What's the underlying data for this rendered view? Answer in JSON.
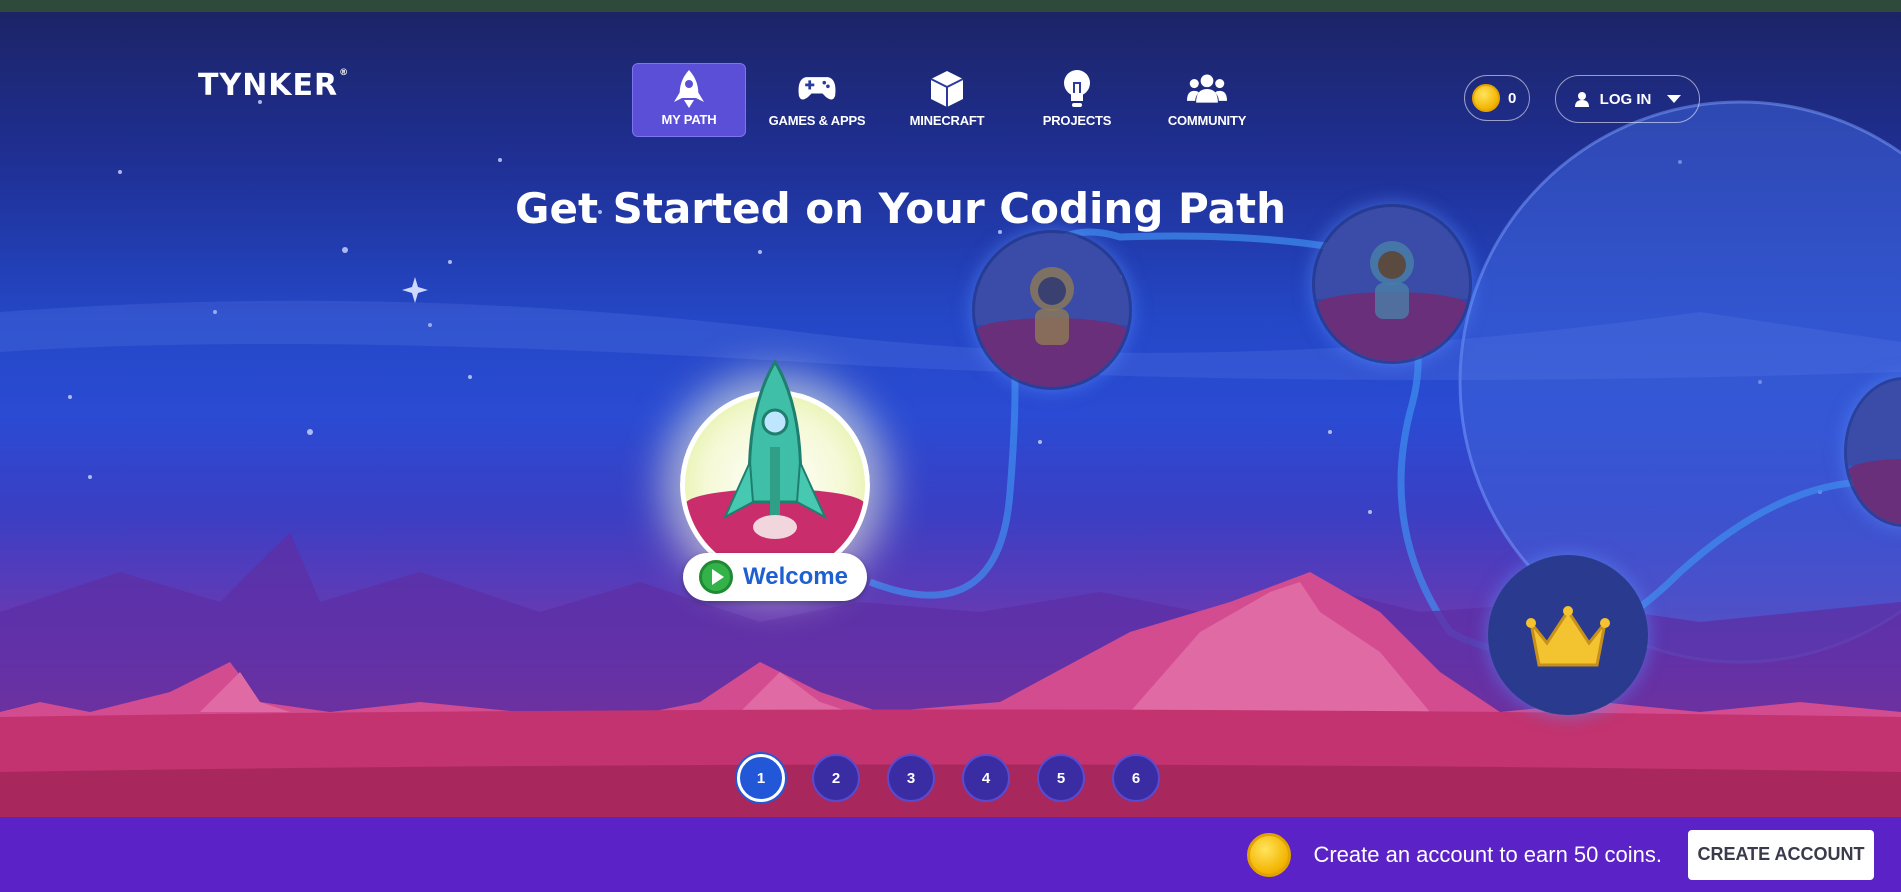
{
  "brand": {
    "logo_text": "TYNKER",
    "logo_mark": "®"
  },
  "nav": {
    "items": [
      {
        "label": "MY PATH",
        "icon": "rocket-icon",
        "active": true
      },
      {
        "label": "GAMES & APPS",
        "icon": "gamepad-icon",
        "active": false
      },
      {
        "label": "MINECRAFT",
        "icon": "cube-icon",
        "active": false
      },
      {
        "label": "PROJECTS",
        "icon": "lightbulb-icon",
        "active": false
      },
      {
        "label": "COMMUNITY",
        "icon": "people-icon",
        "active": false
      }
    ]
  },
  "header": {
    "coins": "0",
    "login_label": "LOG IN"
  },
  "main": {
    "headline": "Get Started on Your Coding Path",
    "welcome_label": "Welcome"
  },
  "pagination": {
    "pages": [
      "1",
      "2",
      "3",
      "4",
      "5",
      "6"
    ],
    "current": "1"
  },
  "promo": {
    "message": "Create an account to earn 50 coins.",
    "button_label": "CREATE ACCOUNT"
  },
  "colors": {
    "accent": "#5b4fd8",
    "bottom_bar": "#5b22c8",
    "welcome_text": "#1f5fd0",
    "play_green": "#33b249"
  }
}
